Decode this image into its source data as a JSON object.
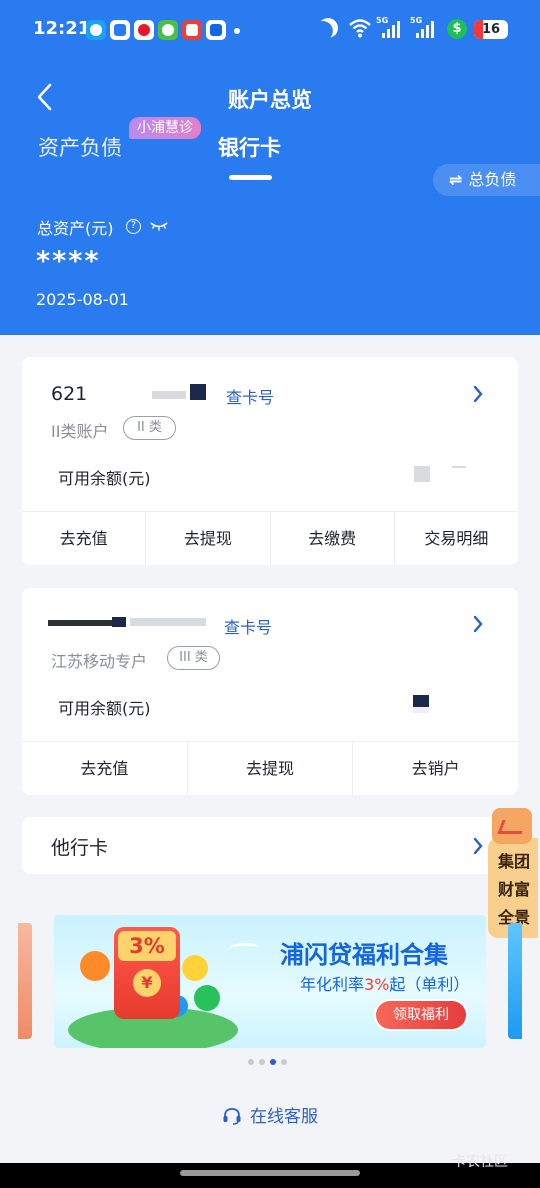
{
  "status_bar": {
    "time": "12:21",
    "signal1_label": "5G",
    "signal2_label": "5G",
    "battery": "16",
    "money_symbol": "$"
  },
  "nav": {
    "title": "账户总览"
  },
  "tabs": {
    "assets": "资产负债",
    "bank_cards": "银行卡",
    "badge": "小浦慧诊"
  },
  "debt_button": {
    "label": "总负债",
    "icon": "⇌"
  },
  "summary": {
    "label": "总资产(元)",
    "value": "****",
    "date": "2025-08-01"
  },
  "cards": [
    {
      "number": "621",
      "check_label": "查卡号",
      "type": "II类账户",
      "pill": "II 类",
      "balance_label": "可用余额(元)",
      "actions": [
        "去充值",
        "去提现",
        "去缴费",
        "交易明细"
      ]
    },
    {
      "check_label": "查卡号",
      "type": "江苏移动专户",
      "pill": "III 类",
      "balance_label": "可用余额(元)",
      "actions": [
        "去充值",
        "去提现",
        "去销户"
      ]
    }
  ],
  "other_cards": {
    "label": "他行卡"
  },
  "float_wealth": {
    "lines": [
      "集团",
      "财富",
      "全景"
    ]
  },
  "banner": {
    "title": "浦闪贷福利合集",
    "sub_prefix": "年化利率",
    "sub_rate": "3%",
    "sub_suffix": "起（单利）",
    "button": "领取福利",
    "envelope_pct": "3%",
    "envelope_coin": "¥"
  },
  "carousel": {
    "count": 4,
    "active": 2
  },
  "service": {
    "label": "在线客服"
  },
  "watermark": "卡农社区",
  "colors": {
    "primary": "#2a7af0",
    "link": "#2a5fc7",
    "accent_red": "#ef3b3b"
  }
}
